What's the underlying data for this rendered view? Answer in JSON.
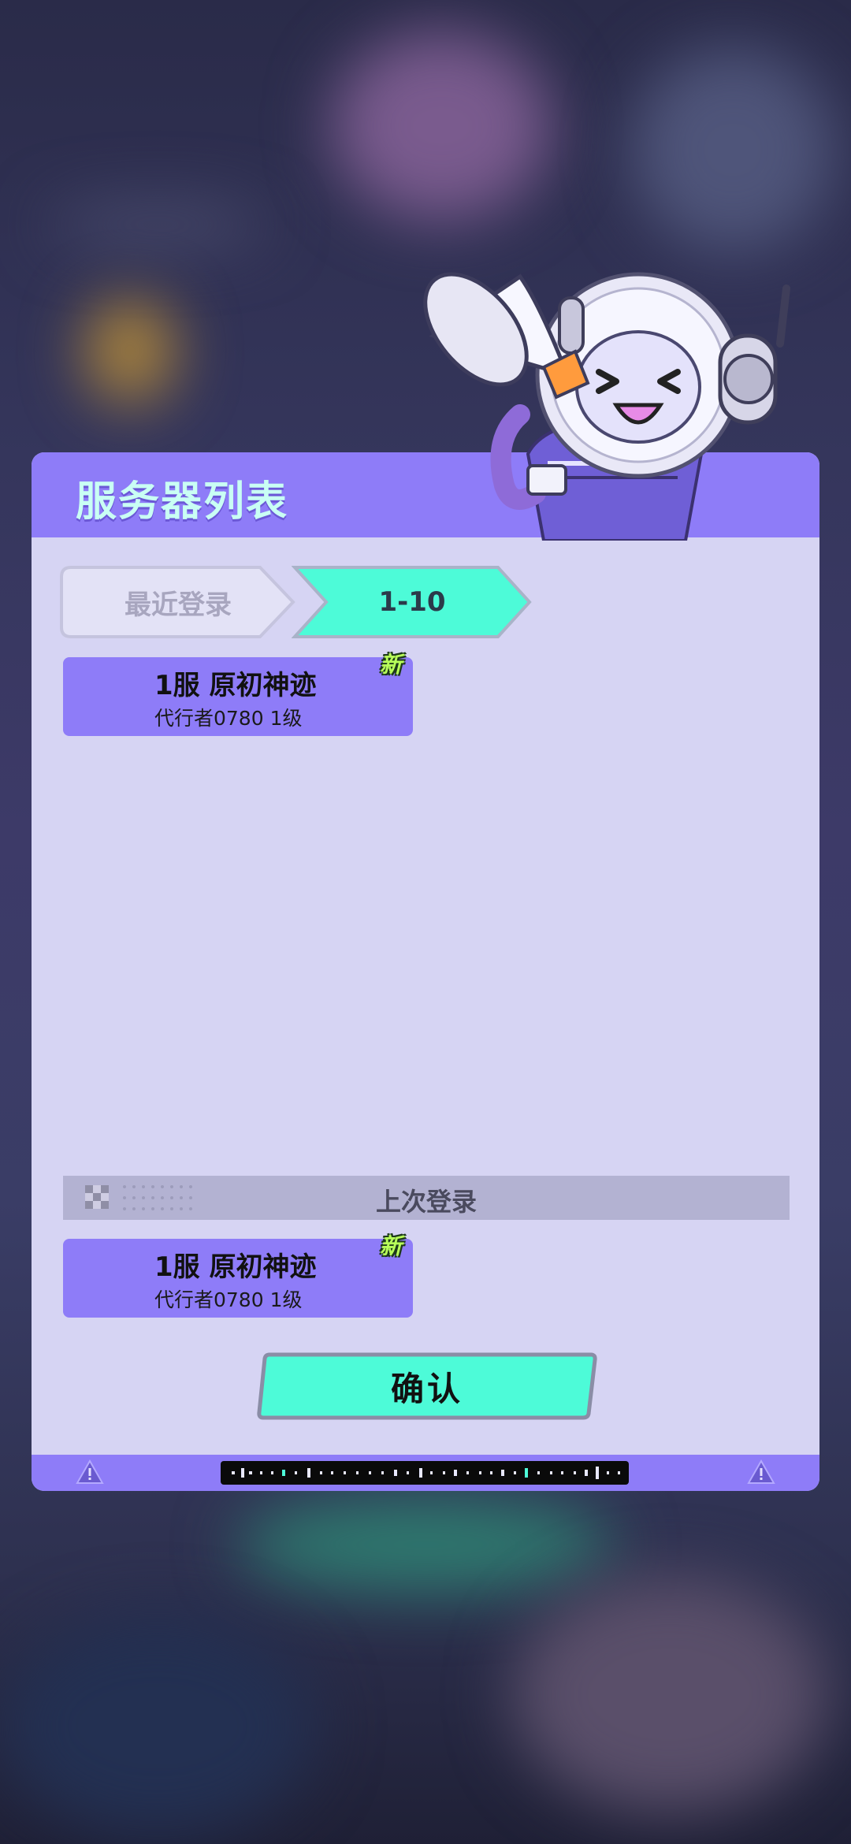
{
  "panel": {
    "title": "服务器列表"
  },
  "tabs": [
    {
      "label": "最近登录",
      "active": false
    },
    {
      "label": "1-10",
      "active": true
    }
  ],
  "servers": [
    {
      "name": "1服 原初神迹",
      "player": "代行者0780 1级",
      "badge": "新"
    }
  ],
  "last_login": {
    "label": "上次登录",
    "server": {
      "name": "1服 原初神迹",
      "player": "代行者0780 1级",
      "badge": "新"
    }
  },
  "confirm_label": "确认",
  "colors": {
    "accent": "#8e7cf8",
    "panel": "#d6d4f3",
    "highlight": "#4dfbd8",
    "badge": "#b8ff5a"
  },
  "icons": [
    "mascot-icon",
    "megaphone-icon",
    "warning-icon"
  ]
}
